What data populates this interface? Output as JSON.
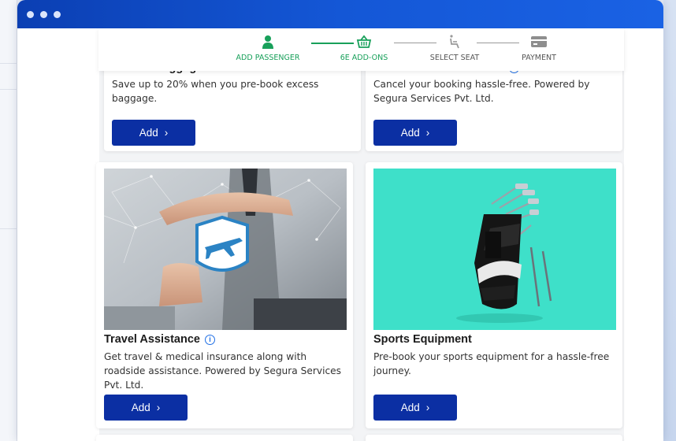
{
  "stepper": {
    "steps": [
      {
        "label": "ADD PASSENGER",
        "icon": "person-icon",
        "state": "done"
      },
      {
        "label": "6E ADD-ONS",
        "icon": "basket-icon",
        "state": "active"
      },
      {
        "label": "SELECT SEAT",
        "icon": "seat-icon",
        "state": "pending"
      },
      {
        "label": "PAYMENT",
        "icon": "card-icon",
        "state": "pending"
      }
    ]
  },
  "cards": {
    "excess_baggage": {
      "title": "Excess Baggage",
      "description": "Save up to 20% when you pre-book excess baggage.",
      "button": "Add"
    },
    "cancellation": {
      "title": "Cancellation Assistance",
      "description": "Cancel your booking hassle-free. Powered by Segura Services Pvt. Ltd.",
      "button": "Add"
    },
    "travel_assistance": {
      "title": "Travel Assistance",
      "description": "Get travel & medical insurance along with roadside assistance. Powered by Segura Services Pvt. Ltd.",
      "button": "Add"
    },
    "sports_equipment": {
      "title": "Sports Equipment",
      "description": "Pre-book your sports equipment for a hassle-free journey.",
      "button": "Add"
    }
  },
  "colors": {
    "accent": "#0b2fa3",
    "success": "#18a05a",
    "titlebar": "#1457d6",
    "sports_bg": "#3ee0c9",
    "info": "#1f6fe5"
  }
}
